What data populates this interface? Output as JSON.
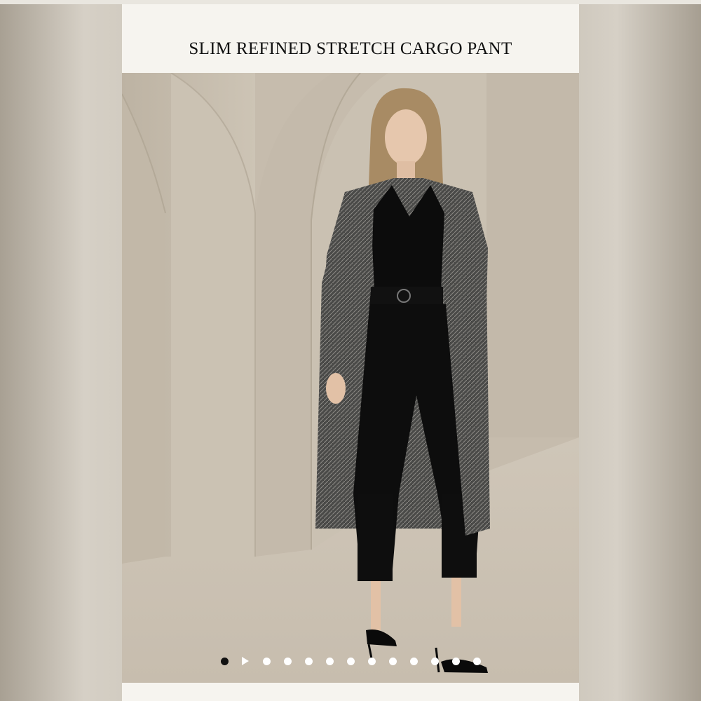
{
  "product": {
    "title": "SLIM REFINED STRETCH CARGO PANT"
  },
  "gallery": {
    "image_alt": "Model wearing black slim cargo pants, black top, herringbone long coat and strappy heels",
    "slide_count": 13,
    "active_index": 0,
    "video_index": 1,
    "indicator_color": "#ffffff",
    "active_indicator_color": "#111111"
  },
  "colors": {
    "card": "#f6f4ef",
    "wall": "#c9bfb0",
    "outfit": "#0c0c0c"
  }
}
